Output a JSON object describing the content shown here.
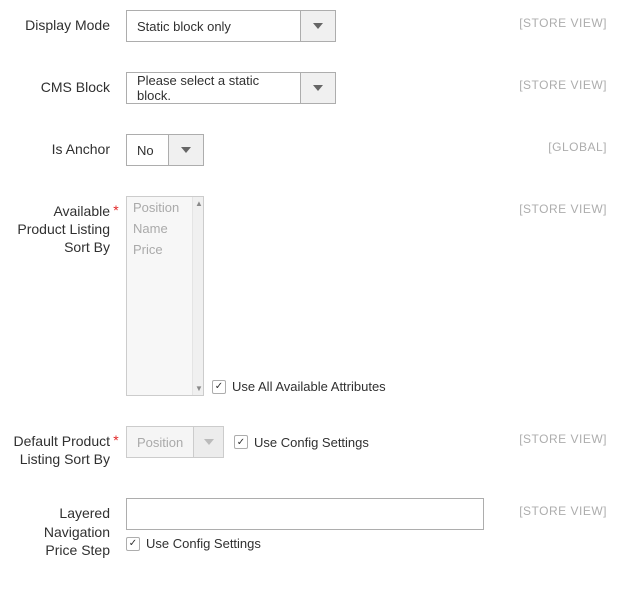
{
  "rows": {
    "displayMode": {
      "label": "Display Mode",
      "value": "Static block only",
      "scope": "[STORE VIEW]"
    },
    "cmsBlock": {
      "label": "CMS Block",
      "value": "Please select a static block.",
      "scope": "[STORE VIEW]"
    },
    "isAnchor": {
      "label": "Is Anchor",
      "value": "No",
      "scope": "[GLOBAL]"
    },
    "availableSort": {
      "label": "Available Product Listing Sort By",
      "options": [
        "Position",
        "Name",
        "Price"
      ],
      "checkboxLabel": "Use All Available Attributes",
      "scope": "[STORE VIEW]"
    },
    "defaultSort": {
      "label": "Default Product Listing Sort By",
      "value": "Position",
      "checkboxLabel": "Use Config Settings",
      "scope": "[STORE VIEW]"
    },
    "priceStep": {
      "label": "Layered Navigation Price Step",
      "value": "",
      "checkboxLabel": "Use Config Settings",
      "scope": "[STORE VIEW]"
    }
  }
}
